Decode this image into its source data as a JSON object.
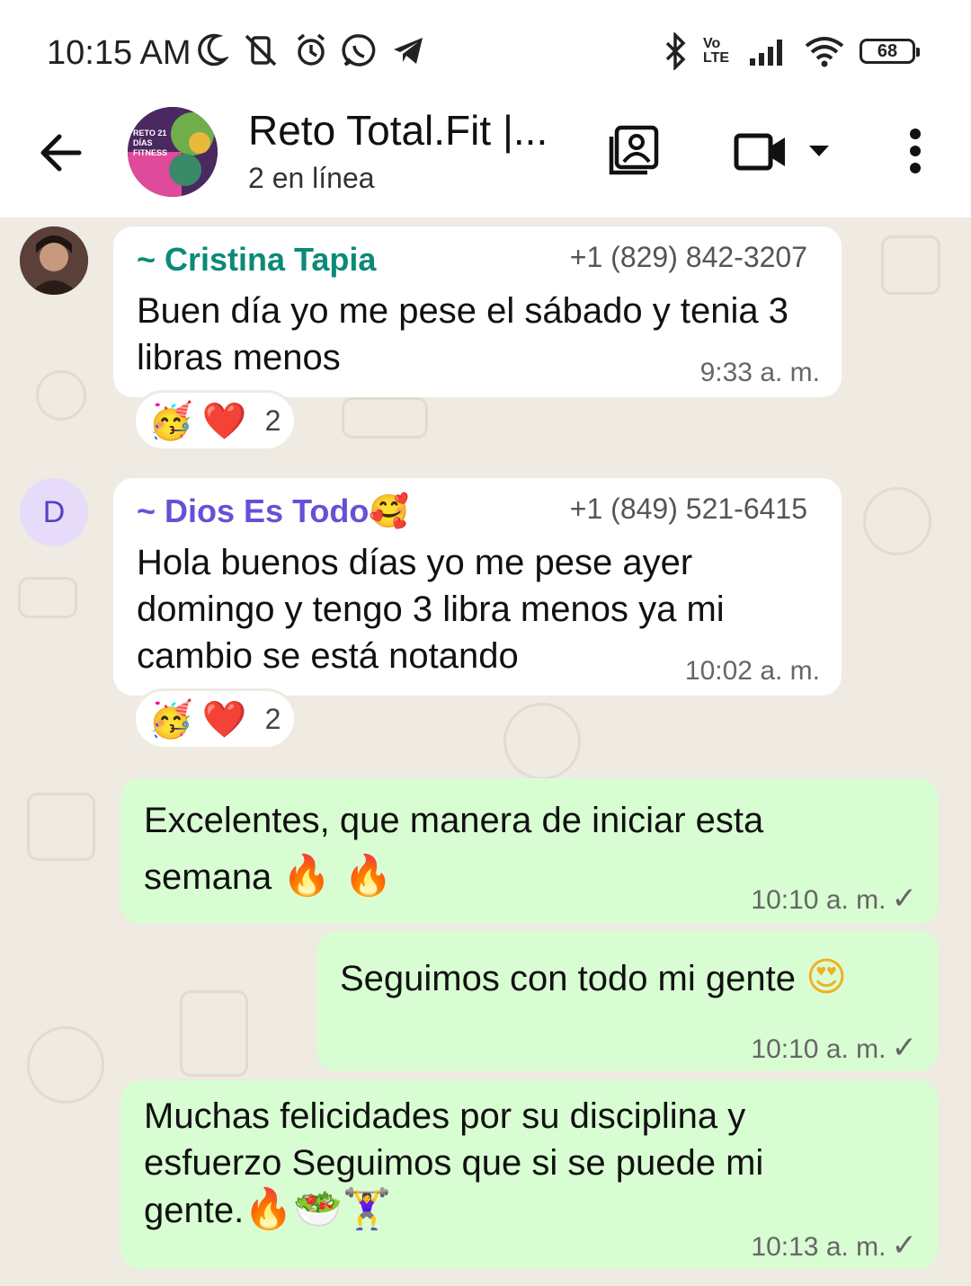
{
  "status_bar": {
    "time": "10:15 AM",
    "battery": "68",
    "network": "Vo LTE"
  },
  "header": {
    "title": "Reto Total.Fit |...",
    "subtitle": "2 en línea",
    "avatar_text": "RETO 21 DÍAS FITNESS"
  },
  "messages": [
    {
      "type": "incoming",
      "sender": "~ Cristina Tapia",
      "sender_color": "#0b8a77",
      "phone": "+1 (829) 842-3207",
      "text": "Buen día yo me pese el sábado y tenia 3 libras menos",
      "time": "9:33 a. m.",
      "reactions": [
        "🥳",
        "❤️"
      ],
      "reaction_count": "2"
    },
    {
      "type": "incoming",
      "sender": "~ Dios Es Todo",
      "sender_emoji": "🥰",
      "sender_color": "#6a4fd6",
      "avatar_letter": "D",
      "phone": "+1 (849) 521-6415",
      "text": "Hola buenos días yo me pese ayer domingo y tengo 3 libra menos ya mi cambio se está notando",
      "time": "10:02 a. m.",
      "reactions": [
        "🥳",
        "❤️"
      ],
      "reaction_count": "2"
    },
    {
      "type": "outgoing",
      "text_line1": "Excelentes, que manera de iniciar esta",
      "text_line2": "semana",
      "emoji": "🔥 🔥",
      "time": "10:10 a. m."
    },
    {
      "type": "outgoing",
      "text": "Seguimos con todo mi gente",
      "emoji": "😍",
      "time": "10:10 a. m."
    },
    {
      "type": "outgoing",
      "text_line1": "Muchas felicidades por su disciplina y",
      "text_line2": "esfuerzo Seguimos que si se puede mi",
      "text_line3": "gente.",
      "emoji": "🔥🥗🏋️‍♀️",
      "time": "10:13 a. m."
    }
  ],
  "colors": {
    "incoming_bubble": "#ffffff",
    "outgoing_bubble": "#d9fdd3",
    "wallpaper": "#efeae2"
  }
}
